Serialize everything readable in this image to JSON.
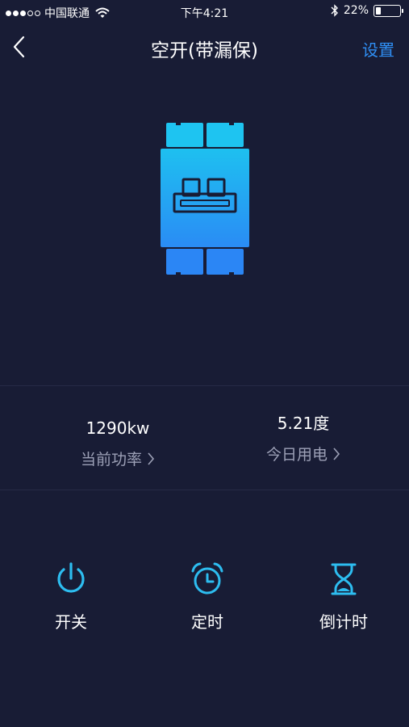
{
  "status_bar": {
    "carrier": "中国联通",
    "time": "下午4:21",
    "battery_percent": "22%",
    "battery_level": 0.22,
    "signal_bars": 3,
    "signal_total": 5
  },
  "nav": {
    "title": "空开(带漏保)",
    "settings_label": "设置"
  },
  "device": {
    "icon": "circuit-breaker-icon",
    "gradient_top": "#1ec0f0",
    "gradient_bottom": "#2a8cf5"
  },
  "stats": {
    "power": {
      "value": "1290kw",
      "label": "当前功率"
    },
    "energy": {
      "value": "5.21度",
      "label": "今日用电"
    }
  },
  "actions": [
    {
      "label": "开关",
      "icon": "power-icon"
    },
    {
      "label": "定时",
      "icon": "alarm-clock-icon"
    },
    {
      "label": "倒计时",
      "icon": "hourglass-icon"
    }
  ],
  "colors": {
    "background": "#181c35",
    "accent": "#2f8ff5",
    "icon_accent": "#2dbdf0",
    "secondary_text": "#9ca0b6"
  }
}
